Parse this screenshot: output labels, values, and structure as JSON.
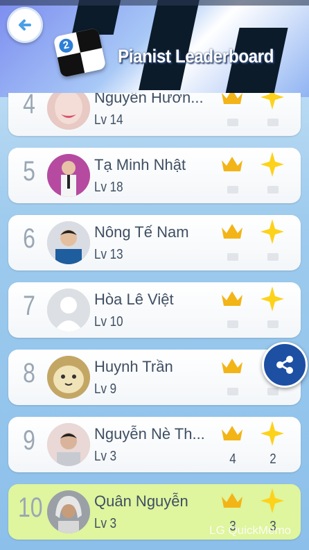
{
  "header": {
    "title": "Pianist Leaderboard",
    "app_icon_number": "2"
  },
  "leaderboard": [
    {
      "rank": "4",
      "name": "Nguyễn Hươn...",
      "level": "Lv 14",
      "crowns": "",
      "stars": ""
    },
    {
      "rank": "5",
      "name": "Tạ Minh Nhật",
      "level": "Lv 18",
      "crowns": "",
      "stars": ""
    },
    {
      "rank": "6",
      "name": "Nông Tế Nam",
      "level": "Lv 13",
      "crowns": "",
      "stars": ""
    },
    {
      "rank": "7",
      "name": "Hòa Lê Việt",
      "level": "Lv 10",
      "crowns": "",
      "stars": ""
    },
    {
      "rank": "8",
      "name": "Huynh Trần",
      "level": "Lv 9",
      "crowns": "",
      "stars": ""
    },
    {
      "rank": "9",
      "name": "Nguyễn Nè Th...",
      "level": "Lv 3",
      "crowns": "4",
      "stars": "2"
    },
    {
      "rank": "10",
      "name": "Quân Nguyễn",
      "level": "Lv 3",
      "crowns": "3",
      "stars": "3",
      "is_current_user": true
    }
  ],
  "watermark": "LG QuickMemo",
  "colors": {
    "current_user_row": "#dff59e",
    "crown": "#f2b417",
    "star": "#fdd21a",
    "share_button": "#1d4fa3"
  }
}
